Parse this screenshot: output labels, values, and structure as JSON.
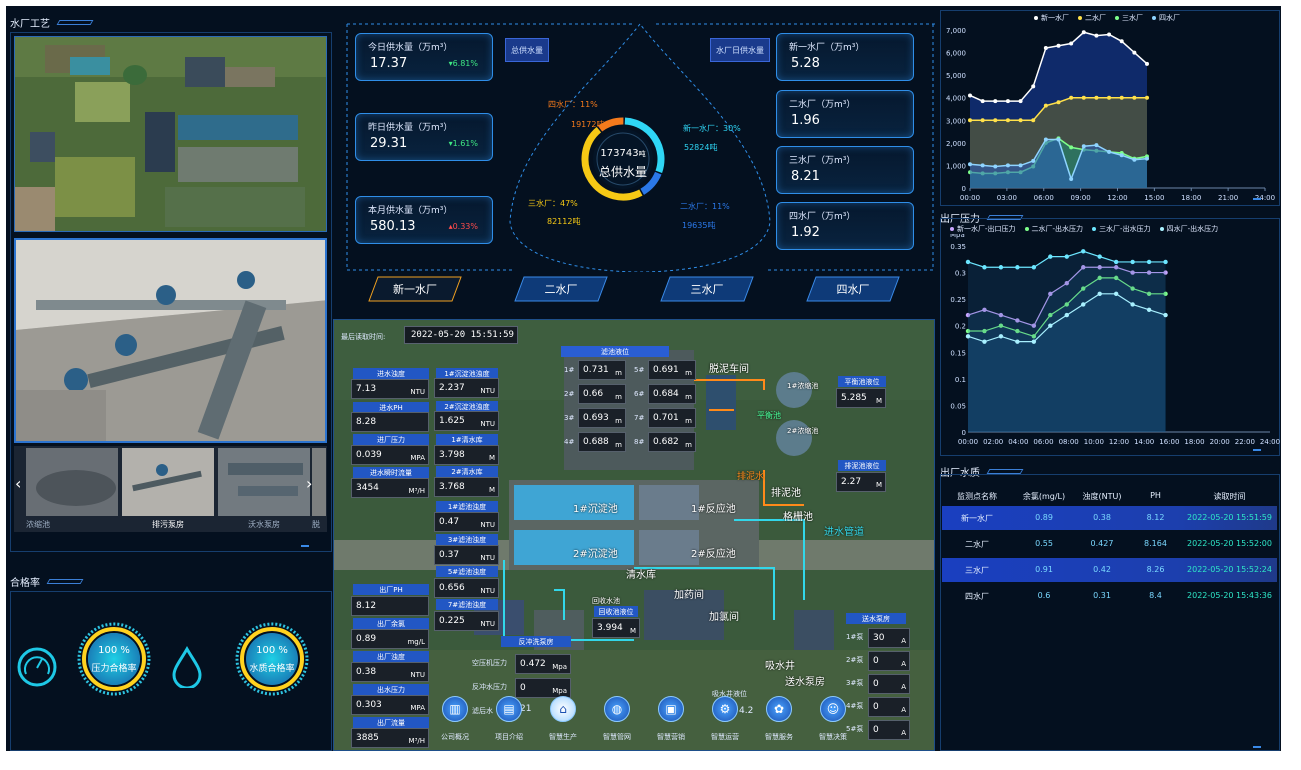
{
  "sections": {
    "process": "水厂工艺",
    "pass_rate": "合格率",
    "outlet_pressure": "出厂压力",
    "outlet_quality": "出厂水质"
  },
  "supply": {
    "total_btn": "总供水量",
    "daily_btn": "水厂日供水量",
    "left_boxes": [
      {
        "title": "今日供水量（万m³）",
        "value": "17.37",
        "pct": "6.81%",
        "dir": "up"
      },
      {
        "title": "昨日供水量（万m³）",
        "value": "29.31",
        "pct": "1.61%",
        "dir": "up"
      },
      {
        "title": "本月供水量（万m³）",
        "value": "580.13",
        "pct": "0.33%",
        "dir": "down"
      }
    ],
    "right_boxes": [
      {
        "title": "新一水厂（万m³）",
        "value": "5.28"
      },
      {
        "title": "二水厂（万m³）",
        "value": "1.96"
      },
      {
        "title": "三水厂（万m³）",
        "value": "8.21"
      },
      {
        "title": "四水厂（万m³）",
        "value": "1.92"
      }
    ],
    "donut": {
      "total_value": "173743",
      "total_unit": "吨",
      "total_label": "总供水量",
      "slices": [
        {
          "label": "新一水厂：30%",
          "amount": "52824吨",
          "pct": 30,
          "color": "#2fd6f5"
        },
        {
          "label": "二水厂：11%",
          "amount": "19635吨",
          "pct": 11,
          "color": "#2b78e8"
        },
        {
          "label": "三水厂：47%",
          "amount": "82112吨",
          "pct": 47,
          "color": "#f6c915"
        },
        {
          "label": "四水厂：11%",
          "amount": "19172吨",
          "pct": 11,
          "color": "#f47a1c"
        }
      ]
    },
    "tabs": [
      "新一水厂",
      "二水厂",
      "三水厂",
      "四水厂"
    ]
  },
  "photos": {
    "labels": [
      "浓缩池",
      "排污泵房",
      "沃水泵房",
      "脱"
    ]
  },
  "pass": {
    "pressure_value": "100 %",
    "pressure_label": "压力合格率",
    "quality_value": "100 %",
    "quality_label": "水质合格率"
  },
  "map": {
    "read_time_label": "最后读取时间:",
    "read_time": "2022-05-20 15:51:59",
    "inlet": [
      {
        "label": "进水浊度",
        "value": "7.13",
        "unit": "NTU"
      },
      {
        "label": "进水PH",
        "value": "8.28",
        "unit": ""
      },
      {
        "label": "进厂压力",
        "value": "0.039",
        "unit": "MPA"
      },
      {
        "label": "进水瞬时流量",
        "value": "3454",
        "unit": "M³/H"
      }
    ],
    "sediment": [
      {
        "label": "1#沉淀池浊度",
        "value": "2.237",
        "unit": "NTU"
      },
      {
        "label": "2#沉淀池浊度",
        "value": "1.625",
        "unit": "NTU"
      },
      {
        "label": "1#清水库",
        "value": "3.798",
        "unit": "M"
      },
      {
        "label": "2#清水库",
        "value": "3.768",
        "unit": "M"
      }
    ],
    "filter_turb": [
      {
        "label": "1#滤池浊度",
        "value": "0.47",
        "unit": "NTU"
      },
      {
        "label": "3#滤池浊度",
        "value": "0.37",
        "unit": "NTU"
      },
      {
        "label": "5#滤池浊度",
        "value": "0.656",
        "unit": "NTU"
      },
      {
        "label": "7#滤池浊度",
        "value": "0.225",
        "unit": "NTU"
      }
    ],
    "outlet": [
      {
        "label": "出厂PH",
        "value": "8.12",
        "unit": ""
      },
      {
        "label": "出厂余氯",
        "value": "0.89",
        "unit": "mg/L"
      },
      {
        "label": "出厂浊度",
        "value": "0.38",
        "unit": "NTU"
      },
      {
        "label": "出水压力",
        "value": "0.303",
        "unit": "MPA"
      },
      {
        "label": "出厂流量",
        "value": "3885",
        "unit": "M³/H"
      }
    ],
    "filter_level_title": "滤池液位",
    "filter_levels": [
      {
        "n": "1#",
        "v": "0.731"
      },
      {
        "n": "5#",
        "v": "0.691"
      },
      {
        "n": "2#",
        "v": "0.66"
      },
      {
        "n": "6#",
        "v": "0.684"
      },
      {
        "n": "3#",
        "v": "0.693"
      },
      {
        "n": "7#",
        "v": "0.701"
      },
      {
        "n": "4#",
        "v": "0.688"
      },
      {
        "n": "8#",
        "v": "0.682"
      }
    ],
    "filter_level_unit": "m",
    "balance_label": "平衡池液位",
    "balance_value": "5.285",
    "balance_unit": "M",
    "sludge_label": "排泥池液位",
    "sludge_value": "2.27",
    "sludge_unit": "M",
    "recover_label": "回收池液位",
    "recover_value": "3.994",
    "recover_unit": "M",
    "backwash_title": "反冲洗泵房",
    "backwash": [
      {
        "label": "空压机压力",
        "value": "0.472",
        "unit": "Mpa"
      },
      {
        "label": "反冲水压力",
        "value": "0",
        "unit": "Mpa"
      },
      {
        "label": "滤后水",
        "value": "21",
        "unit": ""
      }
    ],
    "pump_title": "送水泵房",
    "pumps": [
      {
        "n": "1#泵",
        "v": "30",
        "u": "A"
      },
      {
        "n": "2#泵",
        "v": "0",
        "u": "A"
      },
      {
        "n": "3#泵",
        "v": "0",
        "u": "A"
      },
      {
        "n": "4#泵",
        "v": "0",
        "u": "A"
      },
      {
        "n": "5#泵",
        "v": "0",
        "u": "A"
      }
    ],
    "suction_label": "吸水井液位",
    "suction_value": "4.2",
    "places": {
      "sludge_room": "脱泥车间",
      "thick1": "1#浓缩池",
      "thick2": "2#浓缩池",
      "balance_pool": "平衡池",
      "sed1": "1#沉淀池",
      "sed2": "2#沉淀池",
      "react1": "1#反应池",
      "react2": "2#反应池",
      "drain": "排泥池",
      "drain_road": "排泥水",
      "grid": "格栅池",
      "inlet_pipe": "进水管道",
      "clear": "清水库",
      "recover_pool": "回收水池",
      "dosing": "加药间",
      "chlor": "加氯间",
      "suction": "吸水井",
      "pump_house": "送水泵房"
    }
  },
  "nav": [
    "公司概况",
    "项目介绍",
    "智慧生产",
    "智慧管网",
    "智慧营销",
    "智慧运营",
    "智慧服务",
    "智慧决策"
  ],
  "charts": {
    "supply_trend": {
      "type": "area",
      "legend": [
        "新一水厂",
        "二水厂",
        "三水厂",
        "四水厂"
      ],
      "x_ticks": [
        "00:00",
        "03:00",
        "06:00",
        "09:00",
        "12:00",
        "15:00",
        "18:00",
        "21:00",
        "24:00"
      ],
      "y_ticks": [
        "0",
        "1,000",
        "2,000",
        "3,000",
        "4,000",
        "5,000",
        "6,000",
        "7,000"
      ],
      "ylim": [
        0,
        7000
      ],
      "series": [
        {
          "name": "新一水厂",
          "color": "#ffffff",
          "fill": "#1a3fa8",
          "values": [
            4100,
            3850,
            3850,
            3850,
            3850,
            4500,
            6200,
            6300,
            6400,
            6900,
            6750,
            6800,
            6500,
            6000,
            5500
          ]
        },
        {
          "name": "二水厂",
          "color": "#ffe14a",
          "fill": "#6f6a28",
          "values": [
            3000,
            3000,
            3000,
            3000,
            3000,
            3000,
            3650,
            3800,
            4000,
            4000,
            4000,
            4000,
            4000,
            4000,
            4000
          ]
        },
        {
          "name": "三水厂",
          "color": "#7dff8a",
          "fill": "#1e8f74",
          "values": [
            700,
            650,
            650,
            700,
            700,
            950,
            2000,
            2200,
            1800,
            1700,
            1650,
            1600,
            1550,
            1300,
            1400
          ]
        },
        {
          "name": "四水厂",
          "color": "#8fd4ff",
          "fill": "#2a5fbf",
          "values": [
            1050,
            1000,
            950,
            1000,
            1000,
            1200,
            2150,
            2150,
            400,
            1850,
            1900,
            1600,
            1450,
            1250,
            1300
          ]
        }
      ]
    },
    "pressure": {
      "type": "line",
      "unit": "Mpa",
      "legend": [
        "新一水厂-出口压力",
        "二水厂-出水压力",
        "三水厂-出水压力",
        "四水厂-出水压力"
      ],
      "x_ticks": [
        "00:00",
        "02:00",
        "04:00",
        "06:00",
        "08:00",
        "10:00",
        "12:00",
        "14:00",
        "16:00",
        "18:00",
        "20:00",
        "22:00",
        "24:00"
      ],
      "y_ticks": [
        "0",
        "0.05",
        "0.1",
        "0.15",
        "0.2",
        "0.25",
        "0.3",
        "0.35"
      ],
      "ylim": [
        0,
        0.35
      ],
      "series": [
        {
          "name": "新一水厂-出口压力",
          "color": "#c9a6ff",
          "values": [
            0.22,
            0.23,
            0.22,
            0.21,
            0.2,
            0.26,
            0.28,
            0.31,
            0.31,
            0.31,
            0.3,
            0.3,
            0.3
          ]
        },
        {
          "name": "二水厂-出水压力",
          "color": "#7dff8a",
          "values": [
            0.19,
            0.19,
            0.2,
            0.19,
            0.18,
            0.22,
            0.24,
            0.27,
            0.29,
            0.29,
            0.27,
            0.26,
            0.26
          ]
        },
        {
          "name": "三水厂-出水压力",
          "color": "#6ce6ff",
          "values": [
            0.32,
            0.31,
            0.31,
            0.31,
            0.31,
            0.33,
            0.33,
            0.34,
            0.33,
            0.32,
            0.32,
            0.32,
            0.32
          ]
        },
        {
          "name": "四水厂-出水压力",
          "color": "#a8f0ff",
          "values": [
            0.18,
            0.17,
            0.18,
            0.17,
            0.17,
            0.2,
            0.22,
            0.24,
            0.26,
            0.26,
            0.24,
            0.23,
            0.22
          ]
        }
      ]
    }
  },
  "quality": {
    "headers": [
      "监测点名称",
      "余氯(mg/L)",
      "浊度(NTU)",
      "PH",
      "读取时间"
    ],
    "rows": [
      [
        "新一水厂",
        "0.89",
        "0.38",
        "8.12",
        "2022-05-20 15:51:59"
      ],
      [
        "二水厂",
        "0.55",
        "0.427",
        "8.164",
        "2022-05-20 15:52:00"
      ],
      [
        "三水厂",
        "0.91",
        "0.42",
        "8.26",
        "2022-05-20 15:52:24"
      ],
      [
        "四水厂",
        "0.6",
        "0.31",
        "8.4",
        "2022-05-20 15:43:36"
      ]
    ]
  }
}
